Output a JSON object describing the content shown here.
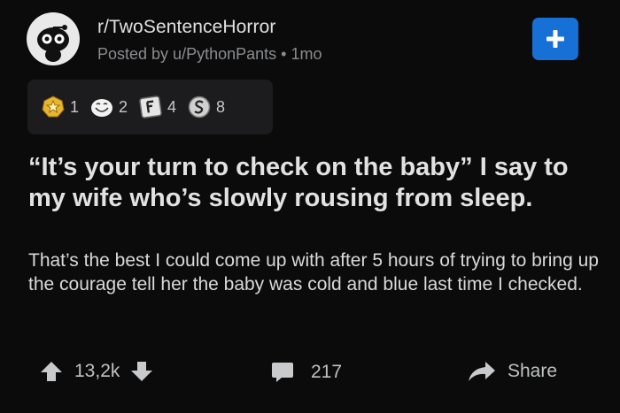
{
  "post": {
    "subreddit": "r/TwoSentenceHorror",
    "posted_by": "Posted by u/PythonPants",
    "age": "1mo",
    "title": "“It’s your turn to check on the baby” I say to my wife who’s slowly rousing from sleep.",
    "body": "That’s the best I could come up with after 5 hours of trying to bring up the courage tell her the baby was cold and blue last time I checked."
  },
  "awards": [
    {
      "icon": "gold-star-award-icon",
      "count": "1"
    },
    {
      "icon": "wholesome-award-icon",
      "count": "2"
    },
    {
      "icon": "press-f-award-icon",
      "count": "4"
    },
    {
      "icon": "silver-award-icon",
      "count": "8"
    }
  ],
  "footer": {
    "score": "13,2k",
    "comments": "217",
    "share_label": "Share"
  },
  "colors": {
    "background": "#0b0b0b",
    "join_button": "#1670d6",
    "awards_panel": "#1c1c1e"
  }
}
